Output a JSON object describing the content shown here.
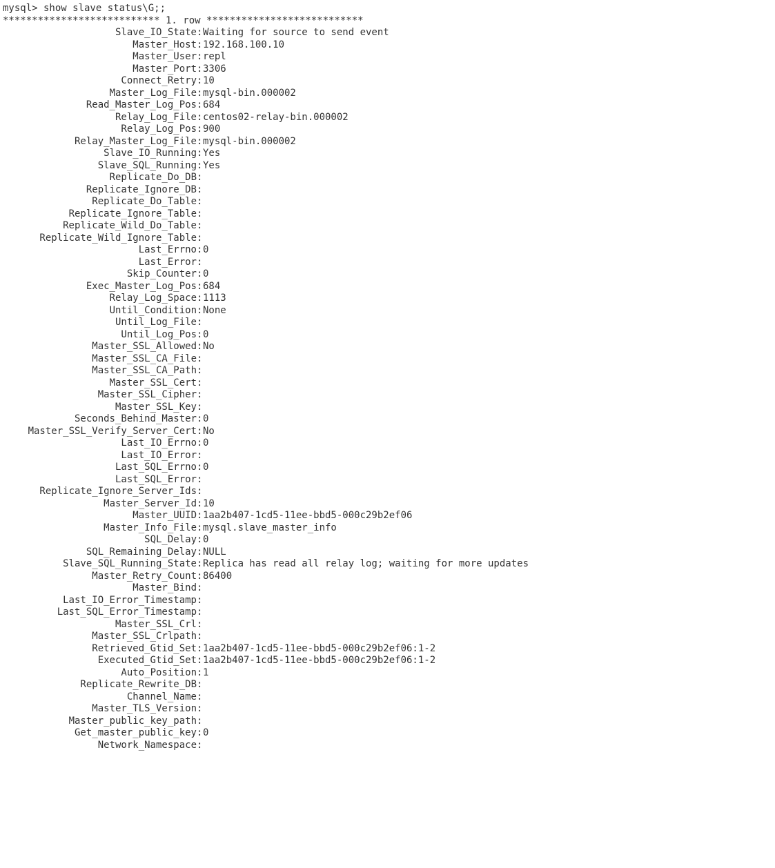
{
  "prompt": "mysql> show slave status\\G;;",
  "separator": "*************************** 1. row ***************************",
  "rows": [
    {
      "k": "Slave_IO_State",
      "v": "Waiting for source to send event"
    },
    {
      "k": "Master_Host",
      "v": "192.168.100.10"
    },
    {
      "k": "Master_User",
      "v": "repl"
    },
    {
      "k": "Master_Port",
      "v": "3306"
    },
    {
      "k": "Connect_Retry",
      "v": "10"
    },
    {
      "k": "Master_Log_File",
      "v": "mysql-bin.000002"
    },
    {
      "k": "Read_Master_Log_Pos",
      "v": "684"
    },
    {
      "k": "Relay_Log_File",
      "v": "centos02-relay-bin.000002"
    },
    {
      "k": "Relay_Log_Pos",
      "v": "900"
    },
    {
      "k": "Relay_Master_Log_File",
      "v": "mysql-bin.000002"
    },
    {
      "k": "Slave_IO_Running",
      "v": "Yes"
    },
    {
      "k": "Slave_SQL_Running",
      "v": "Yes"
    },
    {
      "k": "Replicate_Do_DB",
      "v": ""
    },
    {
      "k": "Replicate_Ignore_DB",
      "v": ""
    },
    {
      "k": "Replicate_Do_Table",
      "v": ""
    },
    {
      "k": "Replicate_Ignore_Table",
      "v": ""
    },
    {
      "k": "Replicate_Wild_Do_Table",
      "v": ""
    },
    {
      "k": "Replicate_Wild_Ignore_Table",
      "v": ""
    },
    {
      "k": "Last_Errno",
      "v": "0"
    },
    {
      "k": "Last_Error",
      "v": ""
    },
    {
      "k": "Skip_Counter",
      "v": "0"
    },
    {
      "k": "Exec_Master_Log_Pos",
      "v": "684"
    },
    {
      "k": "Relay_Log_Space",
      "v": "1113"
    },
    {
      "k": "Until_Condition",
      "v": "None"
    },
    {
      "k": "Until_Log_File",
      "v": ""
    },
    {
      "k": "Until_Log_Pos",
      "v": "0"
    },
    {
      "k": "Master_SSL_Allowed",
      "v": "No"
    },
    {
      "k": "Master_SSL_CA_File",
      "v": ""
    },
    {
      "k": "Master_SSL_CA_Path",
      "v": ""
    },
    {
      "k": "Master_SSL_Cert",
      "v": ""
    },
    {
      "k": "Master_SSL_Cipher",
      "v": ""
    },
    {
      "k": "Master_SSL_Key",
      "v": ""
    },
    {
      "k": "Seconds_Behind_Master",
      "v": "0"
    },
    {
      "k": "Master_SSL_Verify_Server_Cert",
      "v": "No"
    },
    {
      "k": "Last_IO_Errno",
      "v": "0"
    },
    {
      "k": "Last_IO_Error",
      "v": ""
    },
    {
      "k": "Last_SQL_Errno",
      "v": "0"
    },
    {
      "k": "Last_SQL_Error",
      "v": ""
    },
    {
      "k": "Replicate_Ignore_Server_Ids",
      "v": ""
    },
    {
      "k": "Master_Server_Id",
      "v": "10"
    },
    {
      "k": "Master_UUID",
      "v": "1aa2b407-1cd5-11ee-bbd5-000c29b2ef06"
    },
    {
      "k": "Master_Info_File",
      "v": "mysql.slave_master_info"
    },
    {
      "k": "SQL_Delay",
      "v": "0"
    },
    {
      "k": "SQL_Remaining_Delay",
      "v": "NULL"
    },
    {
      "k": "Slave_SQL_Running_State",
      "v": "Replica has read all relay log; waiting for more updates"
    },
    {
      "k": "Master_Retry_Count",
      "v": "86400"
    },
    {
      "k": "Master_Bind",
      "v": ""
    },
    {
      "k": "Last_IO_Error_Timestamp",
      "v": ""
    },
    {
      "k": "Last_SQL_Error_Timestamp",
      "v": ""
    },
    {
      "k": "Master_SSL_Crl",
      "v": ""
    },
    {
      "k": "Master_SSL_Crlpath",
      "v": ""
    },
    {
      "k": "Retrieved_Gtid_Set",
      "v": "1aa2b407-1cd5-11ee-bbd5-000c29b2ef06:1-2"
    },
    {
      "k": "Executed_Gtid_Set",
      "v": "1aa2b407-1cd5-11ee-bbd5-000c29b2ef06:1-2"
    },
    {
      "k": "Auto_Position",
      "v": "1"
    },
    {
      "k": "Replicate_Rewrite_DB",
      "v": ""
    },
    {
      "k": "Channel_Name",
      "v": ""
    },
    {
      "k": "Master_TLS_Version",
      "v": ""
    },
    {
      "k": "Master_public_key_path",
      "v": ""
    },
    {
      "k": "Get_master_public_key",
      "v": "0"
    },
    {
      "k": "Network_Namespace",
      "v": ""
    }
  ]
}
